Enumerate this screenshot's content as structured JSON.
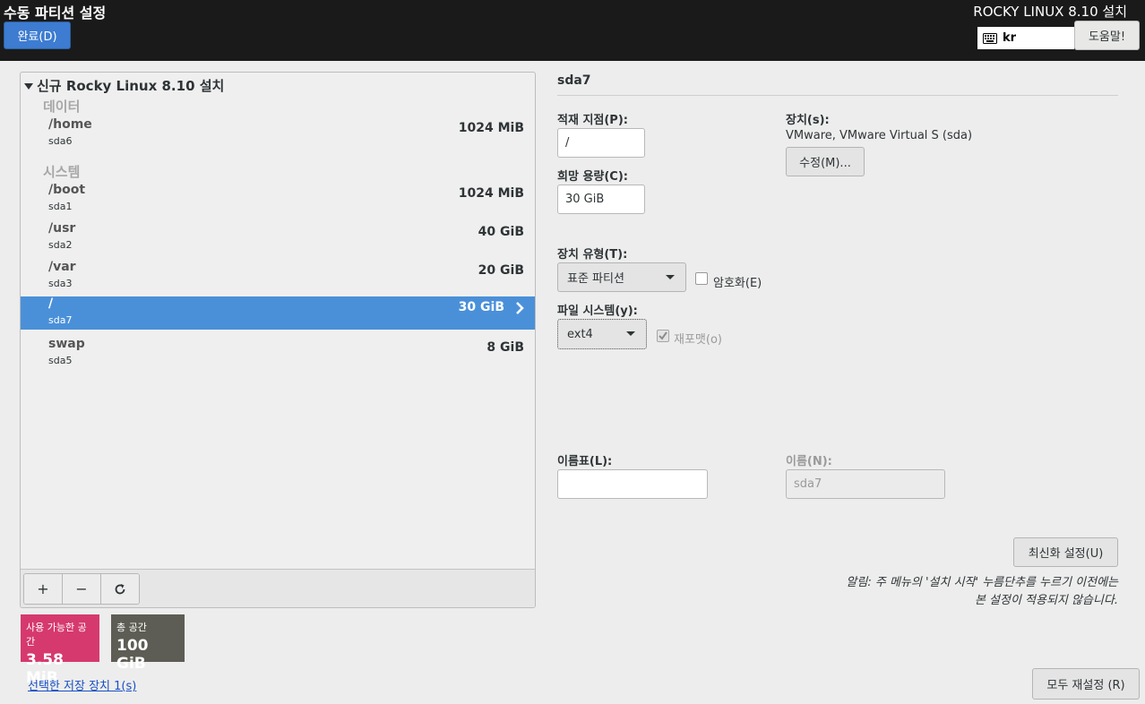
{
  "header": {
    "title": "수동 파티션 설정",
    "done_label": "완료(D)",
    "product": "ROCKY LINUX 8.10 설치",
    "keyboard_layout": "kr",
    "help_label": "도움말!"
  },
  "tree": {
    "group_title": "신규 Rocky Linux 8.10 설치",
    "categories": [
      {
        "name": "데이터",
        "items": [
          {
            "mount": "/home",
            "device": "sda6",
            "size": "1024 MiB"
          }
        ]
      },
      {
        "name": "시스템",
        "items": [
          {
            "mount": "/boot",
            "device": "sda1",
            "size": "1024 MiB"
          },
          {
            "mount": "/usr",
            "device": "sda2",
            "size": "40 GiB"
          },
          {
            "mount": "/var",
            "device": "sda3",
            "size": "20 GiB"
          },
          {
            "mount": "/",
            "device": "sda7",
            "size": "30 GiB",
            "selected": true
          },
          {
            "mount": "swap",
            "device": "sda5",
            "size": "8 GiB"
          }
        ]
      }
    ]
  },
  "toolbar": {
    "add": "+",
    "remove": "−",
    "refresh": "refresh-icon"
  },
  "space": {
    "available_label": "사용 가능한 공간",
    "available_value": "3.58 MiB",
    "total_label": "총 공간",
    "total_value": "100 GiB"
  },
  "storage_link": "선택한 저장 장치 1(s)",
  "details": {
    "title": "sda7",
    "mount_label": "적재 지점(P):",
    "mount_value": "/",
    "capacity_label": "희망 용량(C):",
    "capacity_value": "30 GiB",
    "devices_label": "장치(s):",
    "devices_value": "VMware, VMware Virtual S (sda)",
    "modify_label": "수정(M)...",
    "device_type_label": "장치 유형(T):",
    "device_type_value": "표준 파티션",
    "encrypt_label": "암호화(E)",
    "fs_label": "파일 시스템(y):",
    "fs_value": "ext4",
    "reformat_label": "재포맷(o)",
    "label_label": "이름표(L):",
    "label_value": "",
    "name_label": "이름(N):",
    "name_value": "sda7",
    "update_label": "최신화 설정(U)",
    "note_line1": "알림: 주 메뉴의 '설치 시작' 누름단추를 누르기 이전에는",
    "note_line2": "본 설정이 적용되지 않습니다.",
    "reset_label": "모두 재설정 (R)"
  },
  "colors": {
    "header_bg": "#1a1a1a",
    "accent": "#4a90d9",
    "available_bg": "#d6396e",
    "total_bg": "#5d5d55"
  }
}
